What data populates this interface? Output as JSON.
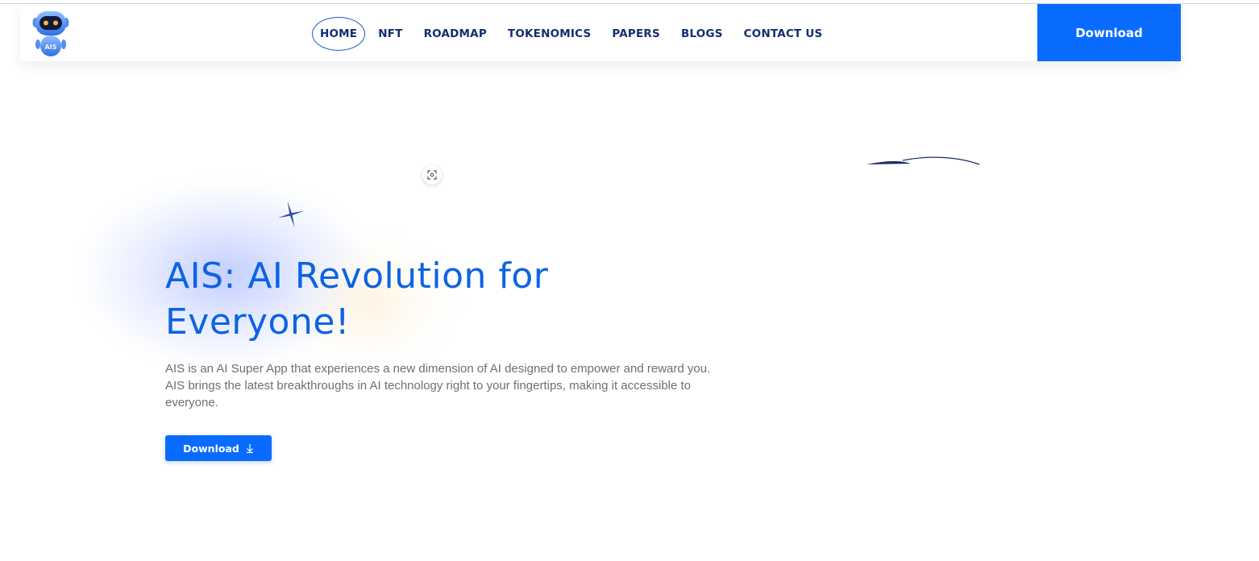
{
  "header": {
    "logo_text": "AIS",
    "nav_items": [
      {
        "label": "HOME",
        "active": true
      },
      {
        "label": "NFT"
      },
      {
        "label": "ROADMAP"
      },
      {
        "label": "TOKENOMICS"
      },
      {
        "label": "PAPERS"
      },
      {
        "label": "BLOGS"
      },
      {
        "label": "CONTACT US"
      }
    ],
    "download_label": "Download"
  },
  "hero": {
    "title": "AIS: AI Revolution for Everyone!",
    "description": "AIS is an AI Super App that experiences a new dimension of AI designed to empower and reward you. AIS brings the latest breakthroughs in AI technology right to your fingertips, making it accessible to everyone.",
    "button_label": "Download",
    "button_icon": "arrow-down-icon"
  },
  "icons": {
    "logo": "robot-icon",
    "sparkle": "sparkle-icon",
    "scan": "scan-icon"
  },
  "colors": {
    "primary": "#0a6cff",
    "nav_text": "#132d72",
    "title": "#0d63e3",
    "body_text": "#6d6f75"
  }
}
